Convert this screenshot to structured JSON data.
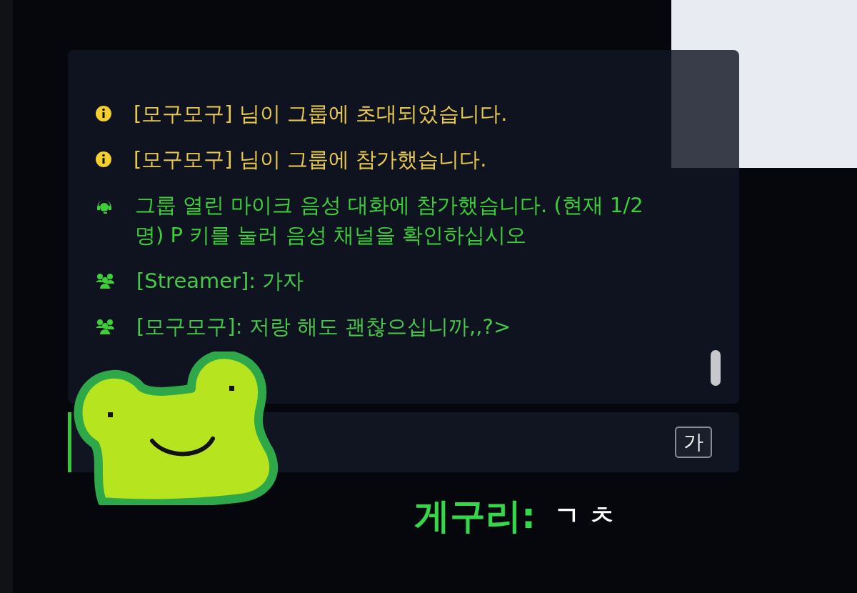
{
  "chat": {
    "messages": [
      {
        "kind": "info",
        "text": "[모구모구] 님이 그룹에 초대되었습니다."
      },
      {
        "kind": "info",
        "text": "[모구모구] 님이 그룹에 참가했습니다."
      },
      {
        "kind": "voice",
        "text": "그룹 열린 마이크 음성 대화에 참가했습니다. (현재 1/2명) P 키를 눌러 음성 채널을 확인하십시오"
      },
      {
        "kind": "group",
        "text": "[Streamer]: 가자"
      },
      {
        "kind": "group",
        "text": "[모구모구]: 저랑 해도 괜찮으십니까,,?>"
      }
    ]
  },
  "input": {
    "ime_mode": "가"
  },
  "caption": {
    "speaker": "게구리:",
    "text": "ㄱ ㅊ"
  }
}
